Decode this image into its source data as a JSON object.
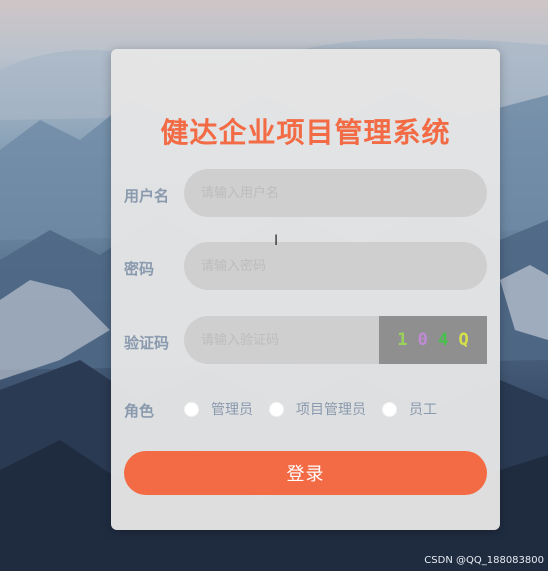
{
  "title": "健达企业项目管理系统",
  "username": {
    "label": "用户名",
    "placeholder": "请输入用户名"
  },
  "password": {
    "label": "密码",
    "placeholder": "请输入密码"
  },
  "captcha": {
    "label": "验证码",
    "placeholder": "请输入验证码",
    "chars": [
      {
        "char": "1",
        "color": "#9ad25a"
      },
      {
        "char": "0",
        "color": "#c08ad6"
      },
      {
        "char": "4",
        "color": "#46c24b"
      },
      {
        "char": "Q",
        "color": "#d6e04a"
      }
    ]
  },
  "role": {
    "label": "角色",
    "options": [
      "管理员",
      "项目管理员",
      "员工"
    ]
  },
  "login_button": "登录",
  "watermark": "CSDN @QQ_188083800",
  "colors": {
    "accent": "#f26b45",
    "label": "#8a9aae"
  }
}
